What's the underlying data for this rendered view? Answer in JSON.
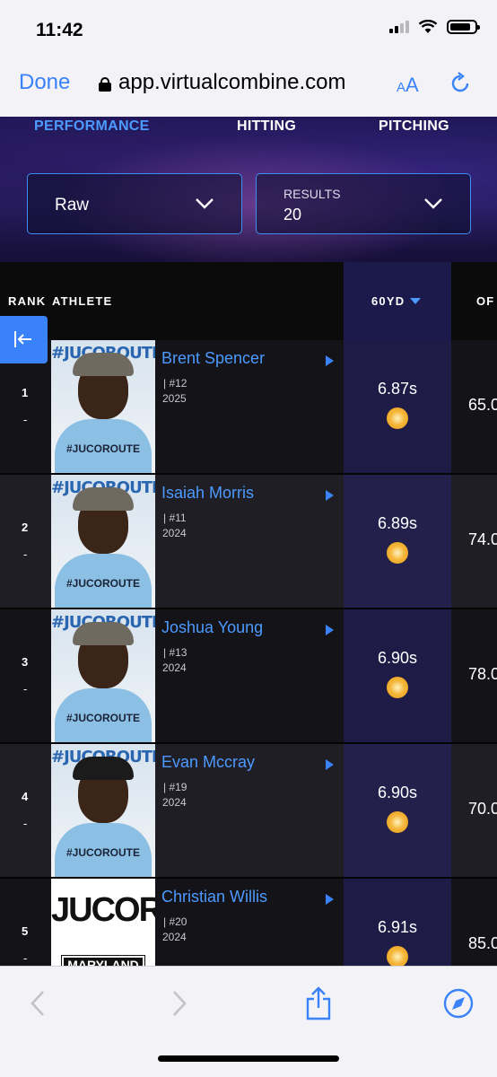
{
  "status": {
    "time": "11:42"
  },
  "browser": {
    "done_label": "Done",
    "url": "app.virtualcombine.com",
    "text_size_label": "AA"
  },
  "tabs": [
    "PERFORMANCE",
    "HITTING",
    "PITCHING"
  ],
  "filters": {
    "mode_value": "Raw",
    "results_label": "RESULTS",
    "results_value": "20"
  },
  "table": {
    "headers": {
      "rank": "RANK",
      "athlete": "ATHLETE",
      "sixty": "60YD",
      "of": "OF"
    },
    "rows": [
      {
        "rank": "1",
        "movement": "-",
        "name": "Brent Spencer",
        "number": "| #12",
        "year": "2025",
        "sixty": "6.87s",
        "of": "65.0"
      },
      {
        "rank": "2",
        "movement": "-",
        "name": "Isaiah Morris",
        "number": "| #11",
        "year": "2024",
        "sixty": "6.89s",
        "of": "74.0"
      },
      {
        "rank": "3",
        "movement": "-",
        "name": "Joshua Young",
        "number": "| #13",
        "year": "2024",
        "sixty": "6.90s",
        "of": "78.0"
      },
      {
        "rank": "4",
        "movement": "-",
        "name": "Evan Mccray",
        "number": "| #19",
        "year": "2024",
        "sixty": "6.90s",
        "of": "70.0"
      },
      {
        "rank": "5",
        "movement": "-",
        "name": "Christian Willis",
        "number": "| #20",
        "year": "2024",
        "sixty": "6.91s",
        "of": "85.0"
      }
    ]
  },
  "photos": {
    "jersey_text": "#JUCOROUTE",
    "banner_text": "#JUCOROUTE",
    "logo_big": "JUCORO",
    "logo_state": "MARYLAND"
  },
  "colors": {
    "accent": "#3a82f7",
    "link": "#4d9aff",
    "highlight_column": "#1c1a4a",
    "medal": "#f5b73b"
  }
}
